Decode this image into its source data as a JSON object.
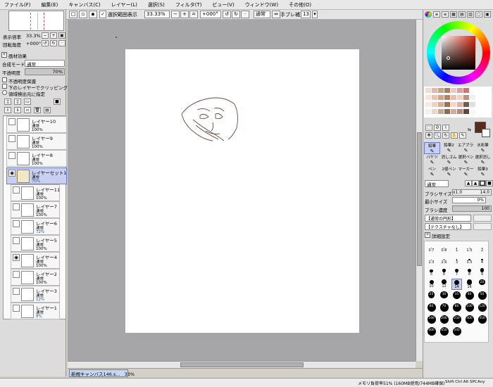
{
  "menu": [
    "ファイル(F)",
    "編集(E)",
    "キャンバス(C)",
    "レイヤー(L)",
    "選択(S)",
    "フィルタ(T)",
    "ビュー(V)",
    "ウィンドウ(W)",
    "その他(O)"
  ],
  "toolbar": {
    "selection_checkbox_label": "選択範囲表示",
    "zoom_value": "33.33%",
    "rotation_value": "+000°",
    "blend_mode": "通常",
    "stabilizer_label": "手ブレ補正",
    "stabilizer_value": "13"
  },
  "navigator": {
    "zoom_label": "表示倍率",
    "zoom_value": "33.3%",
    "angle_label": "回転角度",
    "angle_value": "+000°"
  },
  "layer_panel": {
    "effects_label": "画材効果",
    "blend_label": "合成モード",
    "blend_value": "通常",
    "opacity_label": "不透明度",
    "opacity_value": "70%",
    "protect_label": "不透明度保護",
    "clip_label": "下のレイヤーでクリッピング",
    "source_label": "領域検出元に指定",
    "layers": [
      {
        "name": "レイヤー10",
        "mode": "通常",
        "opacity": "100%"
      },
      {
        "name": "レイヤー9",
        "mode": "通常",
        "opacity": "100%"
      },
      {
        "name": "レイヤー8",
        "mode": "通常",
        "opacity": "100%"
      },
      {
        "name": "レイヤーセット1",
        "mode": "通常",
        "opacity": "70%"
      },
      {
        "name": "レイヤー11",
        "mode": "通常",
        "opacity": "100%"
      },
      {
        "name": "レイヤー7",
        "mode": "通常",
        "opacity": "100%"
      },
      {
        "name": "レイヤー6",
        "mode": "通常",
        "opacity": "72%"
      },
      {
        "name": "レイヤー5",
        "mode": "通常",
        "opacity": "100%"
      },
      {
        "name": "レイヤー4",
        "mode": "通常",
        "opacity": "100%"
      },
      {
        "name": "レイヤー2",
        "mode": "通常",
        "opacity": "100%"
      },
      {
        "name": "レイヤー3",
        "mode": "通常",
        "opacity": "12%"
      },
      {
        "name": "レイヤー1",
        "mode": "通常",
        "opacity": "8%"
      }
    ]
  },
  "tools": {
    "row1": [
      "鉛筆",
      "鉛筆2",
      "エアブラシ",
      "水彩筆"
    ],
    "row2": [
      "バケツ",
      "消しゴム",
      "選択ペン",
      "選択消し"
    ],
    "row3": [
      "ペン",
      "2値ペン",
      "マーカー",
      "鉛筆3"
    ]
  },
  "brush": {
    "mode": "通常",
    "size_label": "ブラシサイズ",
    "size_mult": "x1.0",
    "size_value": "14.0",
    "min_label": "最小サイズ",
    "min_value": "0%",
    "density_label": "ブラシ濃度",
    "density_value": "100",
    "shape_label": "【通常の円形】",
    "texture_label": "【テクスチャなし】",
    "detail_label": "詳細設定",
    "sizes": [
      "0.7",
      "0.8",
      "1",
      "1.5",
      "2",
      "2.3",
      "2.6",
      "3",
      "3.5",
      "4",
      "5",
      "6",
      "7",
      "8",
      "9",
      "10",
      "12",
      "14",
      "16",
      "20",
      "25",
      "30",
      "35",
      "40",
      "50",
      "60",
      "70",
      "80",
      "100",
      "120",
      "160",
      "200",
      "250",
      "300",
      "350",
      "400",
      "450",
      "500"
    ]
  },
  "status": {
    "memory": "メモリ負荷率51% (160MB使用/744MB確保)",
    "keys": "Shift Ctrl Alt SPC",
    "indicator": "Any"
  },
  "taskbar": {
    "doc_name": "新規キャンバス146.s...",
    "doc_zoom": "33%"
  },
  "colors": {
    "swatches": [
      "#f6dcd0",
      "#e6b8a4",
      "#caa088",
      "#a87b62",
      "#f0c8c8",
      "#e0a0a0",
      "#c87878",
      "#ffffff",
      "#f8e4d8",
      "#ecc4ac",
      "#d4a484",
      "#b48464",
      "#e8c0b0",
      "#f4d0c0",
      "#c09080",
      "#f0f0f0",
      "#fce8e0",
      "#f0d0c0",
      "#d8b098",
      "#a07050",
      "#fad4c8",
      "#e4b0a0",
      "#7a5a4a",
      "#e0e0e0",
      "#f8f0e8",
      "#e8d8c8",
      "#c8a888",
      "#8a6a52",
      "#d8a898",
      "#b88878",
      "#604838",
      "#f8f8f8"
    ],
    "fg": "#5a2a1e",
    "bg": "#ffffff"
  }
}
